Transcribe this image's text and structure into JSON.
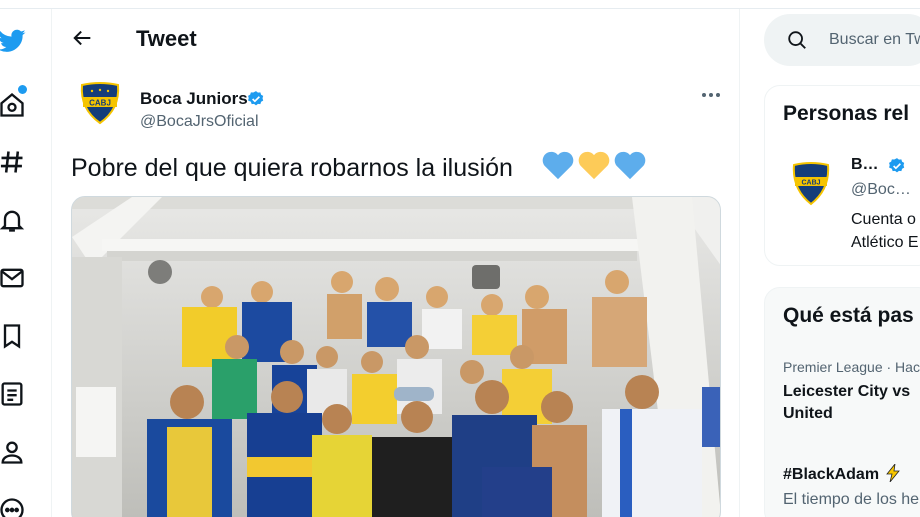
{
  "header": {
    "title": "Tweet"
  },
  "tweet": {
    "author_name": "Boca Juniors",
    "author_handle": "@BocaJrsOficial",
    "text": "Pobre del que quiera robarnos la ilusión",
    "hearts": [
      "blue-heart",
      "yellow-heart",
      "blue-heart"
    ],
    "image_alt": "Boca Juniors players celebrating in the locker room"
  },
  "nav": {
    "items": [
      "twitter-logo",
      "home-icon",
      "explore-icon",
      "notifications-icon",
      "messages-icon",
      "bookmarks-icon",
      "lists-icon",
      "profile-icon",
      "more-icon"
    ]
  },
  "search": {
    "placeholder": "Buscar en Tw"
  },
  "related": {
    "title": "Personas rel",
    "account": {
      "name": "B…",
      "handle": "@Boc…",
      "bio_line1": "Cuenta o",
      "bio_line2": "Atlético E"
    }
  },
  "trends": {
    "title": "Qué está pas",
    "items": [
      {
        "meta": "Premier League · Hac",
        "name_line1": "Leicester City vs",
        "name_line2": "United"
      },
      {
        "name": "#BlackAdam",
        "desc": "El tiempo de los he"
      }
    ]
  },
  "colors": {
    "accent": "#1d9bf0",
    "boca_blue": "#143d7a",
    "boca_gold": "#f5c400"
  }
}
